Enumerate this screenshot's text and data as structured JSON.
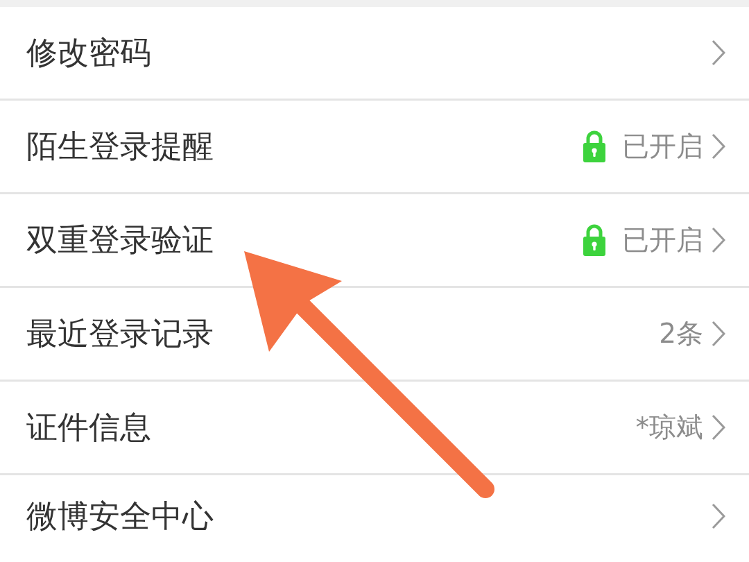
{
  "rows": [
    {
      "kind": "plain",
      "label": "修改密码"
    },
    {
      "kind": "status",
      "label": "陌生登录提醒",
      "value": "已开启"
    },
    {
      "kind": "status",
      "label": "双重登录验证",
      "value": "已开启"
    },
    {
      "kind": "value",
      "label": "最近登录记录",
      "value": "2条"
    },
    {
      "kind": "value",
      "label": "证件信息",
      "value": "*琼斌"
    },
    {
      "kind": "plain",
      "label": "微博安全中心"
    }
  ]
}
